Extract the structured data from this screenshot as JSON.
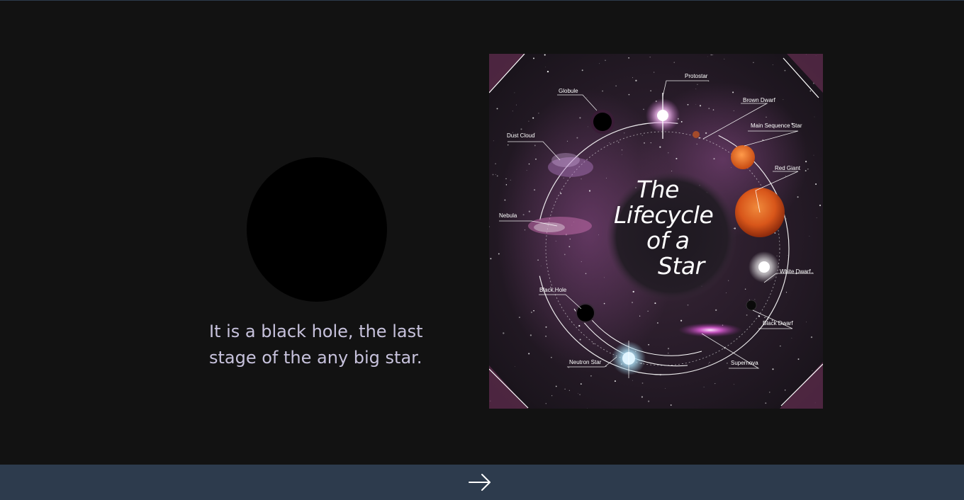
{
  "caption": {
    "line1": "It is a black hole, the last",
    "line2": "stage of the any big star."
  },
  "poster": {
    "title_lines": [
      "The",
      "Lifecycle",
      "of a",
      "Star"
    ],
    "labels": {
      "protostar": "Protostar",
      "globule": "Globule",
      "brown_dwarf": "Brown Dwarf",
      "main_sequence_star": "Main Sequence Star",
      "dust_cloud": "Dust Cloud",
      "red_giant": "Red Giant",
      "nebula": "Nebula",
      "white_dwarf": "White Dwarf",
      "black_hole": "Black Hole",
      "black_dwarf": "Black Dwarf",
      "neutron_star": "Neutron Star",
      "supernova": "Supernova"
    }
  },
  "navigation": {
    "next_icon": "arrow-right-icon"
  },
  "colors": {
    "background": "#121212",
    "bottom_bar": "#2d3b4d",
    "caption_text": "#c7c2dc",
    "black_hole": "#000000"
  }
}
